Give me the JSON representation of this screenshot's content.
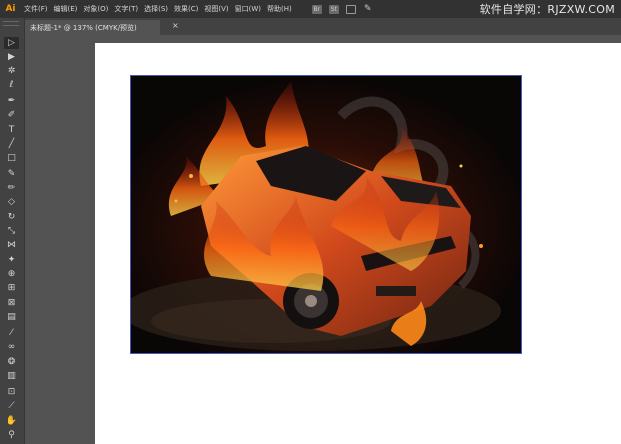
{
  "app": {
    "logo": "Ai"
  },
  "menu": [
    "文件(F)",
    "编辑(E)",
    "对象(O)",
    "文字(T)",
    "选择(S)",
    "效果(C)",
    "视图(V)",
    "窗口(W)",
    "帮助(H)"
  ],
  "bar_icons": [
    {
      "name": "bridge-icon",
      "glyph": "Br"
    },
    {
      "name": "stock-icon",
      "glyph": "St"
    },
    {
      "name": "arrange-documents-icon",
      "glyph": ""
    },
    {
      "name": "brush-feather-icon",
      "glyph": "✎"
    }
  ],
  "watermark": "软件自学网：RJZXW.COM",
  "document_tab": {
    "title": "未标题-1* @ 137% (CMYK/预览)",
    "close": "×"
  },
  "tools": [
    {
      "name": "selection-tool-icon",
      "glyph": "▷"
    },
    {
      "name": "direct-selection-tool-icon",
      "glyph": "▶"
    },
    {
      "name": "magic-wand-tool-icon",
      "glyph": "✲"
    },
    {
      "name": "lasso-tool-icon",
      "glyph": "ℓ"
    },
    {
      "name": "pen-tool-icon",
      "glyph": "✒"
    },
    {
      "name": "curvature-tool-icon",
      "glyph": "✐"
    },
    {
      "name": "type-tool-icon",
      "glyph": "T"
    },
    {
      "name": "line-segment-tool-icon",
      "glyph": "╱"
    },
    {
      "name": "rectangle-tool-icon",
      "glyph": "□"
    },
    {
      "name": "paintbrush-tool-icon",
      "glyph": "✎"
    },
    {
      "name": "pencil-tool-icon",
      "glyph": "✏"
    },
    {
      "name": "eraser-tool-icon",
      "glyph": "◇"
    },
    {
      "name": "rotate-tool-icon",
      "glyph": "↻"
    },
    {
      "name": "scale-tool-icon",
      "glyph": "⤡"
    },
    {
      "name": "width-tool-icon",
      "glyph": "⋈"
    },
    {
      "name": "puppet-warp-tool-icon",
      "glyph": "✦"
    },
    {
      "name": "shape-builder-tool-icon",
      "glyph": "⊕"
    },
    {
      "name": "perspective-grid-tool-icon",
      "glyph": "⊞"
    },
    {
      "name": "mesh-tool-icon",
      "glyph": "⊠"
    },
    {
      "name": "gradient-tool-icon",
      "glyph": "▤"
    },
    {
      "name": "eyedropper-tool-icon",
      "glyph": "⁄"
    },
    {
      "name": "blend-tool-icon",
      "glyph": "∞"
    },
    {
      "name": "symbol-sprayer-tool-icon",
      "glyph": "❂"
    },
    {
      "name": "column-graph-tool-icon",
      "glyph": "▥"
    },
    {
      "name": "artboard-tool-icon",
      "glyph": "⊡"
    },
    {
      "name": "slice-tool-icon",
      "glyph": "⟋"
    },
    {
      "name": "hand-tool-icon",
      "glyph": "✋"
    },
    {
      "name": "zoom-tool-icon",
      "glyph": "⚲"
    }
  ],
  "colors": {
    "menubar": "#323232",
    "panel": "#424242",
    "workspace": "#535353",
    "artboard": "#ffffff",
    "selection_outline": "#4a58b8",
    "logo": "#ff9a00"
  }
}
